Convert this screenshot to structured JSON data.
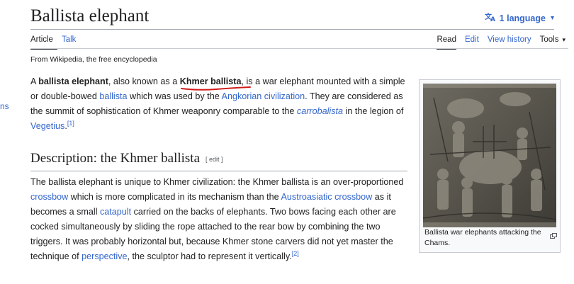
{
  "sidebar_fragment": "ns",
  "page": {
    "title": "Ballista elephant",
    "language_button": "1 language",
    "tabs_left": [
      "Article",
      "Talk"
    ],
    "tabs_right": [
      "Read",
      "Edit",
      "View history"
    ],
    "tools_label": "Tools",
    "tagline": "From Wikipedia, the free encyclopedia"
  },
  "lead": {
    "t1": "A ",
    "b1": "ballista elephant",
    "t2": ", also known as a ",
    "b2": "Khmer ballista",
    "t3": ", is a war elephant mounted with a simple or double-bowed ",
    "l1": "ballista",
    "t4": " which was used by the ",
    "l2": "Angkorian civilization",
    "t5": ". They are considered as the summit of sophistication of Khmer weaponry comparable to the ",
    "l3": "carrobalista",
    "t6": " in the legion of ",
    "l4": "Vegetius",
    "t7": ".",
    "ref": "[1]"
  },
  "section": {
    "heading": "Description: the Khmer ballista",
    "edit_label": "[ edit ]"
  },
  "description": {
    "t1": "The ballista elephant is unique to Khmer civilization: the Khmer ballista is an over-proportioned ",
    "l1": "crossbow",
    "t2": " which is more complicated in its mechanism than the ",
    "l2": "Austroasiatic crossbow",
    "t3": " as it becomes a small ",
    "l3": "catapult",
    "t4": " carried on the backs of elephants. Two bows facing each other are cocked simultaneously by sliding the rope attached to the rear bow by combining the two triggers. It was probably horizontal but, because Khmer stone carvers did not yet master the technique of ",
    "l4": "perspective",
    "t5": ", the sculptor had to represent it vertically.",
    "ref": "[2]"
  },
  "figure": {
    "caption": "Ballista war elephants attacking the Chams."
  },
  "colors": {
    "link": "#3366cc",
    "text": "#202122",
    "annotation_underline": "#d11a1a"
  }
}
